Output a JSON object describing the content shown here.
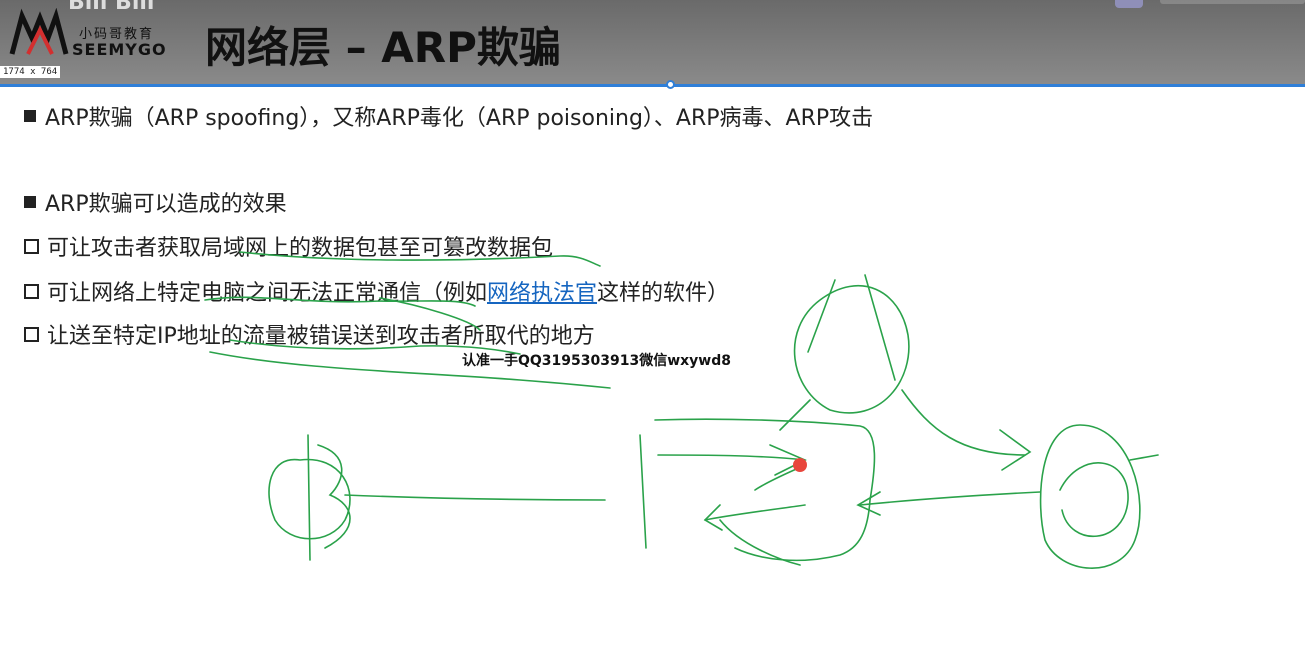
{
  "header": {
    "logo_cn": "小码哥教育",
    "logo_en": "SEEMYGO",
    "title": "网络层 – ARP欺骗",
    "size_badge": "1774 x 764",
    "top_glyph": "Bili Bili"
  },
  "bullets": [
    {
      "id": "b1",
      "marker": "filled",
      "text": "ARP欺骗（ARP spoofing），又称ARP毒化（ARP poisoning）、ARP病毒、ARP攻击"
    },
    {
      "id": "b2",
      "marker": "filled",
      "text": "ARP欺骗可以造成的效果"
    },
    {
      "id": "b3",
      "marker": "hollow",
      "text": "可让攻击者获取局域网上的数据包甚至可篡改数据包"
    },
    {
      "id": "b4",
      "marker": "hollow",
      "text_before": "可让网络上特定电脑之间无法正常通信（例如",
      "link": "网络执法官",
      "text_after": "这样的软件）"
    },
    {
      "id": "b5",
      "marker": "hollow",
      "text": "让送至特定IP地址的流量被错误送到攻击者所取代的地方"
    }
  ],
  "watermark": "认准一手QQ3195303913微信wxywd8",
  "colors": {
    "accent_blue": "#2f7fd8",
    "ink_green": "#2aa24a",
    "laser_red": "#e8463c",
    "link_blue": "#1565c0"
  }
}
